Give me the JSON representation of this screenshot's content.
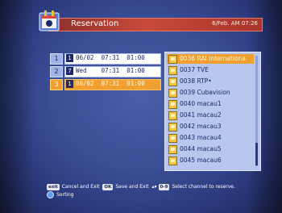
{
  "header": {
    "title": "Reservation",
    "datetime": "6/Feb. AM 07:26",
    "accent_color": "#c84a3a"
  },
  "reservations": [
    {
      "index": "1",
      "type": "1",
      "text": "06/02  07:31  01:00",
      "selected": false
    },
    {
      "index": "2",
      "type": "7",
      "text": "Wed    07:31  01:00",
      "selected": false
    },
    {
      "index": "3",
      "type": "1",
      "text": "06/02  07:31  01:00",
      "selected": true
    }
  ],
  "channels": [
    {
      "label": "0036 RAI Internationa",
      "selected": true
    },
    {
      "label": "0037 TVE",
      "selected": false
    },
    {
      "label": "0038 RTP•",
      "selected": false
    },
    {
      "label": "0039 Cubavision",
      "selected": false
    },
    {
      "label": "0040 macau1",
      "selected": false
    },
    {
      "label": "0041 macau2",
      "selected": false
    },
    {
      "label": "0042 macau3",
      "selected": false
    },
    {
      "label": "0043 macau4",
      "selected": false
    },
    {
      "label": "0044 macau5",
      "selected": false
    },
    {
      "label": "0045 macau6",
      "selected": false
    }
  ],
  "footer": {
    "exit_key": "exit",
    "exit_label": "Cancel and Exit",
    "ok_key": "OK",
    "ok_label": "Save and Exit",
    "nav_key": "0-9",
    "nav_label": "Select channel to reserve.",
    "sort_label": "Sorting",
    "updown_icon": "up-down-arrow-icon"
  }
}
